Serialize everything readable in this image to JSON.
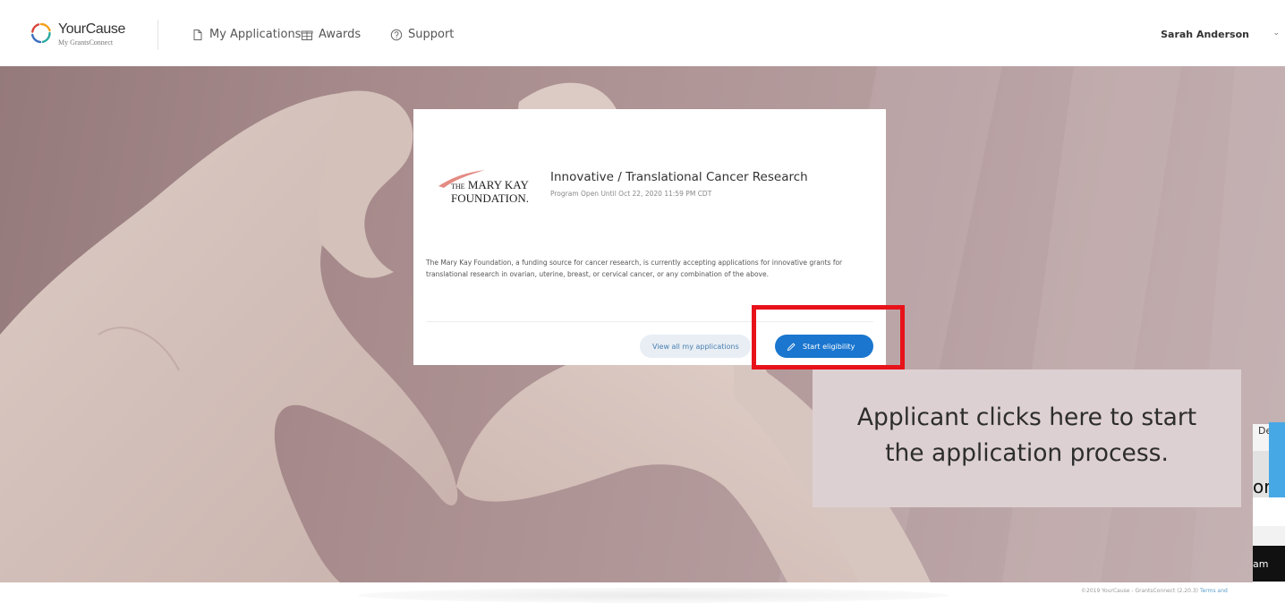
{
  "header": {
    "brand_name": "YourCause",
    "brand_sub": "My GrantsConnect",
    "nav": [
      {
        "label": "My Applications",
        "icon": "document-icon"
      },
      {
        "label": "Awards",
        "icon": "gift-icon"
      },
      {
        "label": "Support",
        "icon": "help-circle-icon"
      }
    ],
    "user_name": "Sarah Anderson",
    "user_caret": "⌄"
  },
  "card": {
    "logo_the": "THE",
    "logo_line1": "MARY KAY",
    "logo_line2": "FOUNDATION.",
    "program_title": "Innovative / Translational Cancer Research",
    "deadline": "Program Open Until Oct 22, 2020 11:59 PM CDT",
    "description": "The Mary Kay Foundation, a funding source for cancer research, is currently accepting applications for innovative grants for translational research in ovarian, uterine, breast, or cervical cancer, or any combination of the above.",
    "view_all_label": "View all my applications",
    "start_label": "Start eligibility"
  },
  "annotation": {
    "callout_line1": "Applicant clicks here to start",
    "callout_line2": "the application process.",
    "highlight_color": "#e8121a"
  },
  "footer": {
    "copyright": "©2019 YourCause - GrantsConnect (2.20.3)",
    "terms": "Terms and"
  },
  "overlap_window": {
    "tab_fragment": "Det",
    "heading_fragment": "or",
    "bar_fragment": "am",
    "accent_color": "#47a8e6"
  },
  "colors": {
    "primary_button": "#1a76cf",
    "secondary_button_bg": "#e8eef4",
    "hero_tone": "#a88c8d"
  }
}
